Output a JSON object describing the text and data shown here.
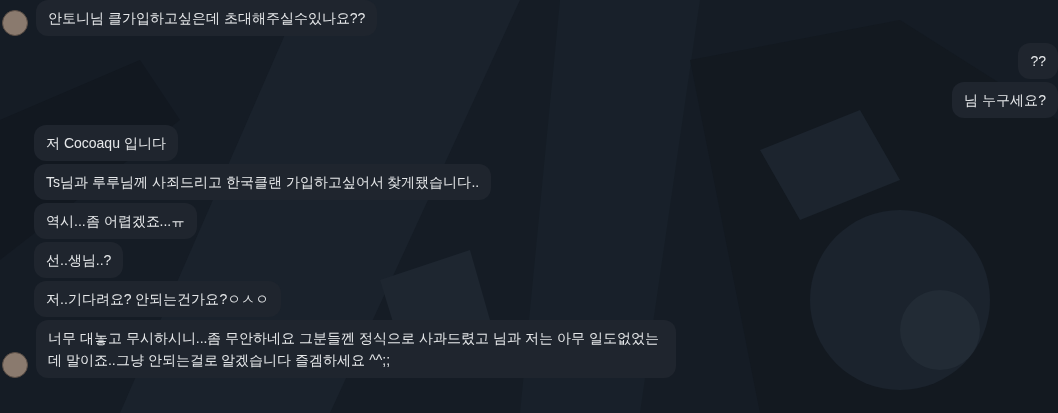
{
  "groups": [
    {
      "kind": "incoming",
      "messages": [
        "안토니님 클가입하고싶은데 초대해주실수있나요??"
      ]
    },
    {
      "kind": "outgoing",
      "messages": [
        "??",
        "님 누구세요?"
      ]
    },
    {
      "kind": "incoming",
      "messages": [
        "저 Cocoaqu 입니다",
        "Ts님과 루루님께 사죄드리고 한국클랜 가입하고싶어서 찾게됐습니다..",
        "역시...좀 어렵겠죠...ㅠ",
        "선..생님..?",
        "저..기다려요? 안되는건가요?ㅇㅅㅇ",
        "너무 대놓고 무시하시니...좀 무안하네요 그분들껜 정식으로 사과드렸고 님과 저는 아무 일도없었는데 말이죠..그냥  안되는걸로 알겠습니다 즐겜하세요 ^^;;"
      ]
    }
  ]
}
